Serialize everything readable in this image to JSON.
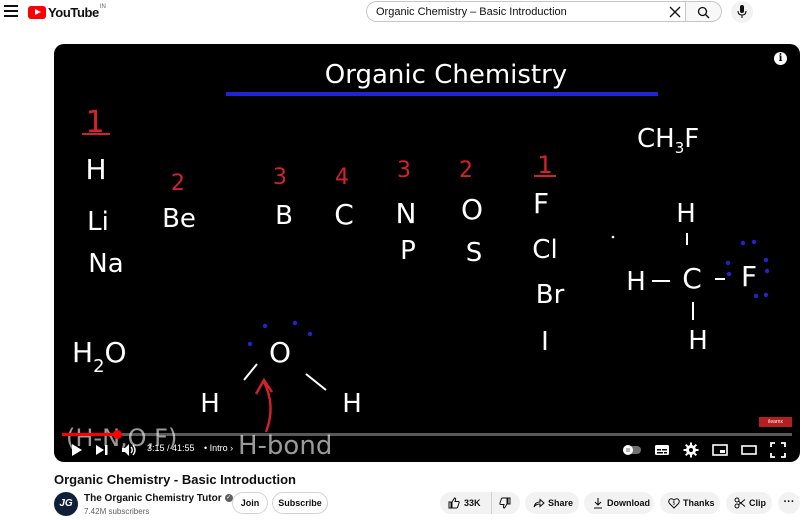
{
  "header": {
    "logo_text": "YouTube",
    "logo_region": "IN",
    "search_value": "Organic Chemistry – Basic Introduction"
  },
  "player": {
    "board": {
      "title": "Organic Chemistry",
      "valence_row1": "1",
      "valence_be": "2",
      "valence_b": "3",
      "valence_c": "4",
      "valence_n": "3",
      "valence_o": "2",
      "valence_f": "1",
      "el_h": "H",
      "el_li": "Li",
      "el_na": "Na",
      "el_be": "Be",
      "el_b": "B",
      "el_c": "C",
      "el_n": "N",
      "el_p": "P",
      "el_o": "O",
      "el_s": "S",
      "el_f": "F",
      "el_cl": "Cl",
      "el_br": "Br",
      "el_i": "I",
      "formula_ch3f_a": "CH",
      "formula_ch3f_sub": "3",
      "formula_ch3f_b": "F",
      "struct_h_top": "H",
      "struct_h_left": "H",
      "struct_c": "C",
      "struct_f": "F",
      "struct_h_bottom": "H",
      "water_h": "H",
      "water_sub": "2",
      "water_o": "O",
      "water_center_o": "O",
      "water_h_left": "H",
      "water_h_right": "H",
      "hbond_atoms": "(H-N,O,F)",
      "hbond_label": "H-bond"
    },
    "watermark": "ilearnx",
    "progress_fraction": 0.076,
    "time": "3:15 / 41:55",
    "chapter": "• Intro ›"
  },
  "video": {
    "title": "Organic Chemistry - Basic Introduction"
  },
  "channel": {
    "avatar_text": "JG",
    "name": "The Organic Chemistry Tutor",
    "subscribers": "7.42M subscribers",
    "join_label": "Join",
    "subscribe_label": "Subscribe"
  },
  "actions": {
    "likes": "33K",
    "share": "Share",
    "download": "Download",
    "thanks": "Thanks",
    "clip": "Clip",
    "more": "···"
  },
  "colors": {
    "youtube_red": "#ff0000",
    "board_red": "#d2222c",
    "board_blue": "#1f24d6",
    "chalk_white": "#ffffff",
    "chalk_gray": "#9a9a9a"
  }
}
